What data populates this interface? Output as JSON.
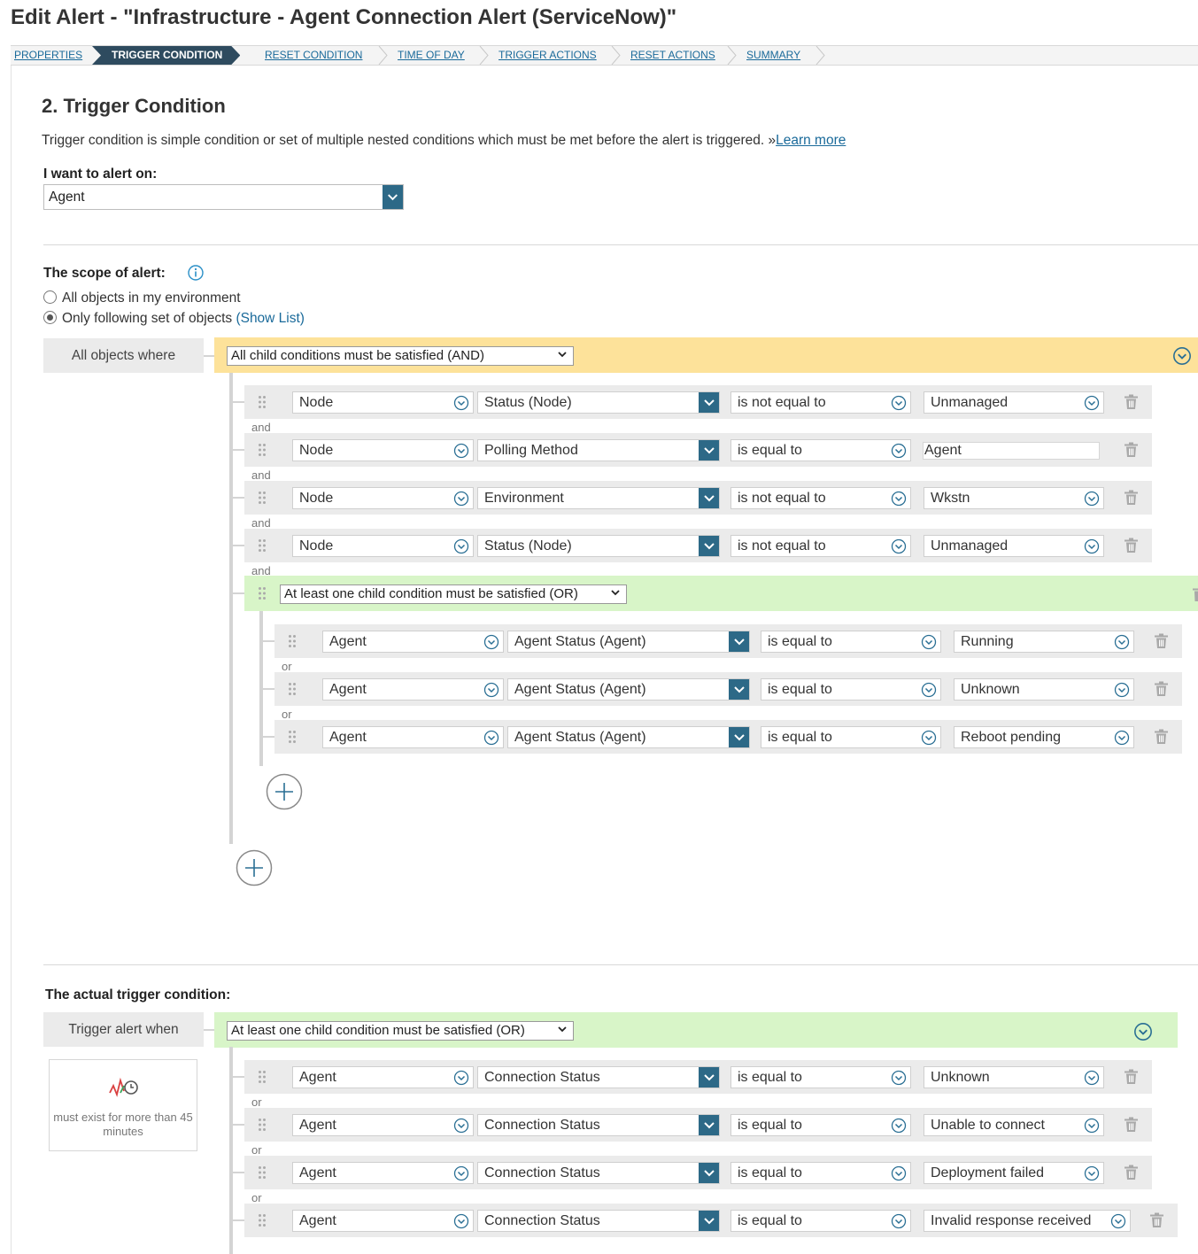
{
  "page": {
    "title": "Edit Alert - \"Infrastructure - Agent Connection Alert (ServiceNow)\""
  },
  "wizard": {
    "steps": [
      "PROPERTIES",
      "TRIGGER CONDITION",
      "RESET CONDITION",
      "TIME OF DAY",
      "TRIGGER ACTIONS",
      "RESET ACTIONS",
      "SUMMARY"
    ],
    "active": "TRIGGER CONDITION"
  },
  "section": {
    "title": "2. Trigger Condition",
    "intro": "Trigger condition is simple condition or set of multiple nested conditions which must be met before the alert is triggered. »",
    "learn_more": "Learn more"
  },
  "alert_on": {
    "label": "I want to alert on:",
    "value": "Agent"
  },
  "scope": {
    "label": "The scope of alert:",
    "option_all": "All objects in my environment",
    "option_following": "Only following set of objects",
    "show_list": "(Show List)",
    "selected": "option_following",
    "where_label": "All objects where",
    "group_mode": "All child conditions must be satisfied (AND)",
    "conditions": [
      {
        "object": "Node",
        "field": "Status (Node)",
        "operator": "is not equal to",
        "value": "Unmanaged",
        "value_kind": "select"
      },
      {
        "object": "Node",
        "field": "Polling Method",
        "operator": "is equal to",
        "value": "Agent",
        "value_kind": "text"
      },
      {
        "object": "Node",
        "field": "Environment",
        "operator": "is not equal to",
        "value": "Wkstn",
        "value_kind": "select"
      },
      {
        "object": "Node",
        "field": "Status (Node)",
        "operator": "is not equal to",
        "value": "Unmanaged",
        "value_kind": "select"
      }
    ],
    "conj": "and",
    "nested_group": {
      "mode": "At least one child condition must be satisfied (OR)",
      "conj": "or",
      "conditions": [
        {
          "object": "Agent",
          "field": "Agent Status (Agent)",
          "operator": "is equal to",
          "value": "Running"
        },
        {
          "object": "Agent",
          "field": "Agent Status (Agent)",
          "operator": "is equal to",
          "value": "Unknown"
        },
        {
          "object": "Agent",
          "field": "Agent Status (Agent)",
          "operator": "is equal to",
          "value": "Reboot pending"
        }
      ]
    }
  },
  "trigger": {
    "label": "The actual trigger condition:",
    "when_label": "Trigger alert when",
    "group_mode": "At least one child condition must be satisfied (OR)",
    "conj": "or",
    "time_condition": {
      "icon": "time-graph-icon",
      "text": "must exist for more than 45 minutes"
    },
    "conditions": [
      {
        "object": "Agent",
        "field": "Connection Status",
        "operator": "is equal to",
        "value": "Unknown"
      },
      {
        "object": "Agent",
        "field": "Connection Status",
        "operator": "is equal to",
        "value": "Unable to connect"
      },
      {
        "object": "Agent",
        "field": "Connection Status",
        "operator": "is equal to",
        "value": "Deployment failed"
      },
      {
        "object": "Agent",
        "field": "Connection Status",
        "operator": "is equal to",
        "value": "Invalid response received"
      }
    ]
  },
  "colors": {
    "accent": "#2d6987",
    "wizard_active": "#2e4b5f",
    "and_group": "#fde29a",
    "or_group": "#d8f5c8",
    "link": "#1a6a9a"
  }
}
